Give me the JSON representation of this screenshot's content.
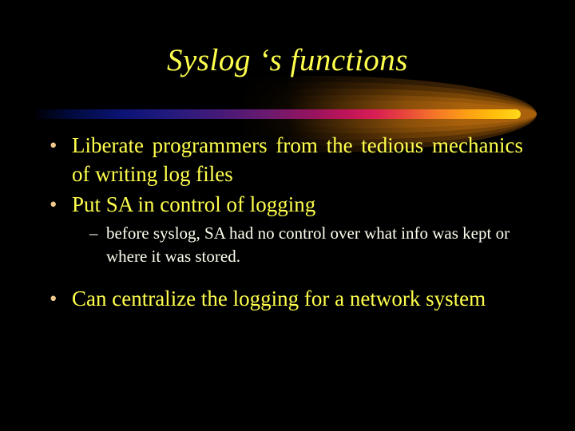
{
  "slide": {
    "background_color": "#000000",
    "title": "Syslog ‘s functions",
    "title_color": "#FFFF4D",
    "body_color": "#FFFF4D",
    "sub_body_color": "#FFFFF0",
    "bullet_marker_color": "#F0C88C",
    "decor": {
      "bar_gradient": [
        "#000006",
        "#0B1375",
        "#451A78",
        "#96135F",
        "#D81E55",
        "#F4732A",
        "#FFD91B"
      ],
      "halo_colors": [
        "#3A2104",
        "#5A3305",
        "#7A4606",
        "#97570A",
        "#A9610C"
      ]
    },
    "bullets": [
      {
        "level": 1,
        "marker": "•",
        "text": "Liberate programmers from the tedious mechanics of writing log files"
      },
      {
        "level": 1,
        "marker": "•",
        "text": "Put SA in control of logging"
      },
      {
        "level": 2,
        "marker": "–",
        "text": "before syslog, SA had no control over what info was kept or where it was stored."
      },
      {
        "level": 1,
        "marker": "•",
        "text": "Can centralize the logging for a network system"
      }
    ]
  }
}
